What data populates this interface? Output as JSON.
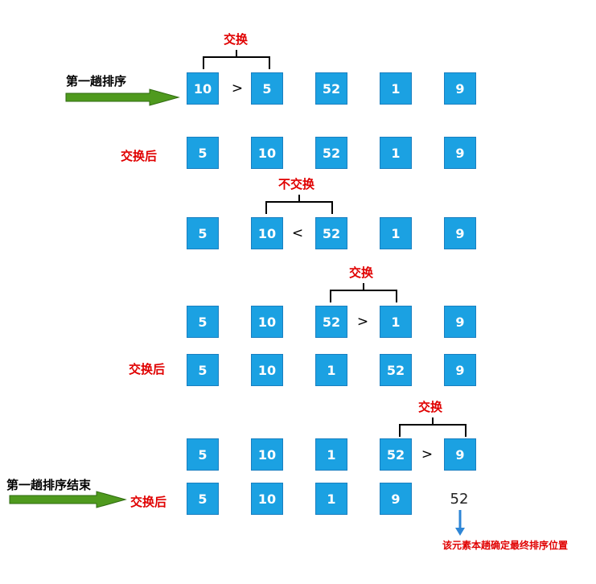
{
  "labels": {
    "first_pass": "第一趟排序",
    "first_pass_end": "第一趟排序结束",
    "after_swap": "交换后",
    "swap": "交换",
    "no_swap": "不交换",
    "final_note": "该元素本趟确定最终排序位置"
  },
  "rows": [
    {
      "values": [
        "10",
        "5",
        "52",
        "1",
        "9"
      ],
      "op": ">"
    },
    {
      "values": [
        "5",
        "10",
        "52",
        "1",
        "9"
      ]
    },
    {
      "values": [
        "5",
        "10",
        "52",
        "1",
        "9"
      ],
      "op": "<"
    },
    {
      "values": [
        "5",
        "10",
        "52",
        "1",
        "9"
      ],
      "op": ">"
    },
    {
      "values": [
        "5",
        "10",
        "1",
        "52",
        "9"
      ]
    },
    {
      "values": [
        "5",
        "10",
        "1",
        "52",
        "9"
      ],
      "op": ">"
    },
    {
      "values": [
        "5",
        "10",
        "1",
        "9"
      ],
      "settled": "52"
    }
  ],
  "colors": {
    "box_fill": "#1ba1e2",
    "label_red": "#e00000",
    "arrow_green": "#4f9a1e",
    "note_arrow_blue": "#2e86d6"
  }
}
